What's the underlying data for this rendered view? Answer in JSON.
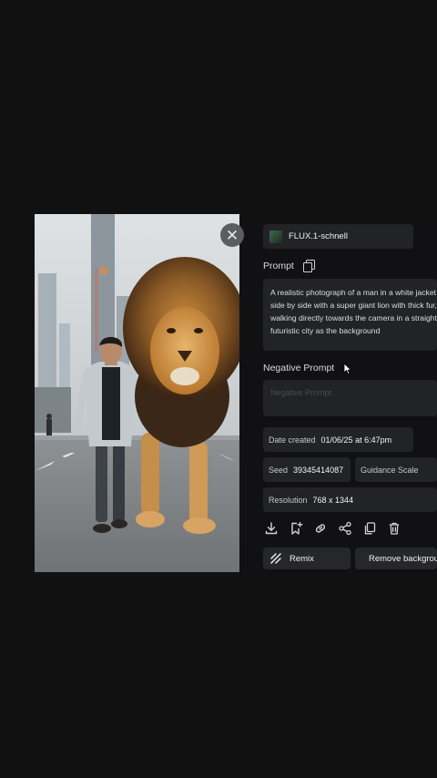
{
  "model": {
    "name": "FLUX.1-schnell",
    "thumb_icon": "model-thumbnail-icon"
  },
  "prompt": {
    "label": "Prompt",
    "text": "A realistic photograph of a man in a white jacket walking side by side with a super giant lion with thick fur, both walking directly towards the camera in a straight line, with a futuristic city as the background"
  },
  "negative_prompt": {
    "label": "Negative Prompt",
    "placeholder": "Negative Prompt"
  },
  "details": {
    "date_key": "Date created",
    "date_value": "01/06/25 at 6:47pm",
    "seed_key": "Seed",
    "seed_value": "39345414087",
    "guidance_key": "Guidance Scale",
    "resolution_key": "Resolution",
    "resolution_value": "768 x 1344"
  },
  "actions": [
    "download-icon",
    "bookmark-add-icon",
    "link-icon",
    "share-icon",
    "copy-icon",
    "trash-icon"
  ],
  "buttons": {
    "remix": "Remix",
    "remove": "Remove background"
  },
  "colors": {
    "background": "#111112",
    "panel": "#222326",
    "text": "#e8e8ea",
    "close_button": "#5c5d61"
  }
}
